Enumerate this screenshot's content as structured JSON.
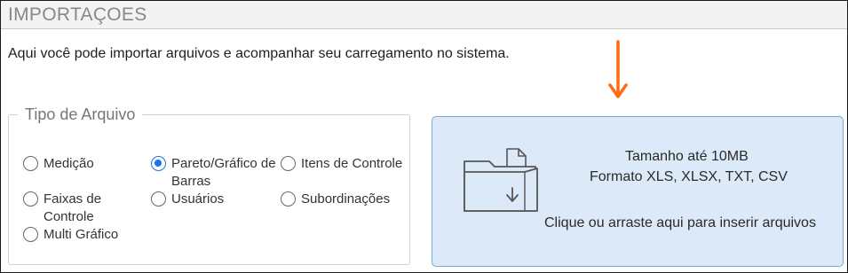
{
  "header": {
    "title": "IMPORTAÇOES"
  },
  "description": "Aqui você pode importar arquivos e acompanhar seu carregamento no sistema.",
  "file_type": {
    "legend": "Tipo de Arquivo",
    "options": [
      {
        "label": "Medição",
        "checked": false
      },
      {
        "label": "Pareto/Gráfico de Barras",
        "checked": true
      },
      {
        "label": "Itens de Controle",
        "checked": false
      },
      {
        "label": "Faixas de Controle",
        "checked": false
      },
      {
        "label": "Usuários",
        "checked": false
      },
      {
        "label": "Subordinações",
        "checked": false
      },
      {
        "label": "Multi Gráfico",
        "checked": false
      }
    ]
  },
  "dropzone": {
    "size_limit": "Tamanho até 10MB",
    "formats": "Formato XLS, XLSX, TXT, CSV",
    "instruction": "Clique ou arraste aqui para inserir arquivos"
  },
  "colors": {
    "arrow": "#ff6a13",
    "radio_selected": "#1e73e8",
    "dropzone_bg": "#dce9f8"
  }
}
